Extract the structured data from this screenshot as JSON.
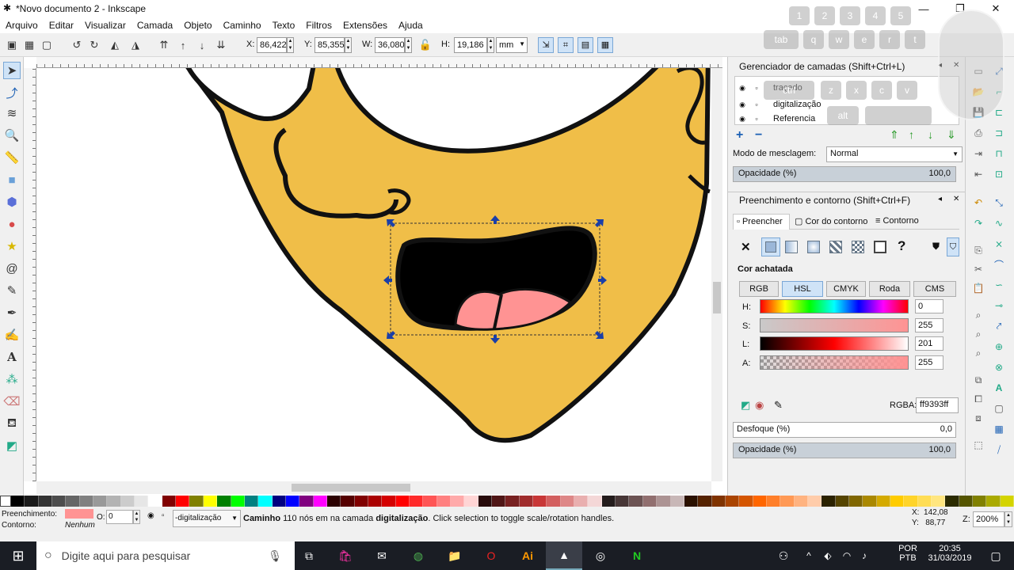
{
  "window": {
    "title": "*Novo documento 2 - Inkscape"
  },
  "menu": [
    "Arquivo",
    "Editar",
    "Visualizar",
    "Camada",
    "Objeto",
    "Caminho",
    "Texto",
    "Filtros",
    "Extensões",
    "Ajuda"
  ],
  "toolbar": {
    "x_label": "X:",
    "x_value": "86,422",
    "y_label": "Y:",
    "y_value": "85,355",
    "w_label": "W:",
    "w_value": "36,080",
    "h_label": "H:",
    "h_value": "19,186",
    "unit": "mm"
  },
  "layers_panel": {
    "title": "Gerenciador de camadas (Shift+Ctrl+L)",
    "layers": [
      "traçado",
      "digitalização",
      "Referencia"
    ],
    "blend_label": "Modo de mesclagem:",
    "blend_value": "Normal",
    "opacity_label": "Opacidade (%)",
    "opacity_value": "100,0"
  },
  "fill_panel": {
    "title": "Preenchimento e contorno (Shift+Ctrl+F)",
    "tabs": [
      "Preencher",
      "Cor do contorno",
      "Contorno"
    ],
    "flat_color_label": "Cor achatada",
    "color_modes": [
      "RGB",
      "HSL",
      "CMYK",
      "Roda",
      "CMS"
    ],
    "active_mode": "HSL",
    "sliders": [
      {
        "label": "H:",
        "value": "0"
      },
      {
        "label": "S:",
        "value": "255"
      },
      {
        "label": "L:",
        "value": "201"
      },
      {
        "label": "A:",
        "value": "255"
      }
    ],
    "rgba_label": "RGBA:",
    "rgba_value": "ff9393ff",
    "blur_label": "Desfoque (%)",
    "blur_value": "0,0",
    "opacity_label": "Opacidade (%)",
    "opacity_value": "100,0"
  },
  "statusbar": {
    "fill_label": "Preenchimento:",
    "stroke_label": "Contorno:",
    "stroke_value": "Nenhum",
    "opacity_label": "O:",
    "opacity_value": "0",
    "layer_value": "-digitalização",
    "msg_bold": "Caminho",
    "msg_mid": " 110 nós em na camada ",
    "msg_layer": "digitalização",
    "msg_end": ". Click selection to toggle scale/rotation handles.",
    "x_coord": "X:  142,08",
    "y_coord": "Y:   88,77",
    "zoom_label": "Z:",
    "zoom_value": "200%"
  },
  "keyboard_overlay": {
    "row1": [
      "1",
      "2",
      "3",
      "4",
      "5"
    ],
    "row2": [
      "tab",
      "q",
      "w",
      "e",
      "r",
      "t"
    ],
    "row3": [
      "ctrl",
      "z",
      "x",
      "c",
      "v"
    ],
    "row4": [
      "alt"
    ]
  },
  "taskbar": {
    "search_placeholder": "Digite aqui para pesquisar",
    "lang_top": "POR",
    "lang_bottom": "PTB",
    "time": "20:35",
    "date": "31/03/2019"
  },
  "colors": {
    "face": "#f0be48",
    "tongue": "#ff9393",
    "handle": "#1a3fa8",
    "selected_fill": "#ff9393"
  }
}
